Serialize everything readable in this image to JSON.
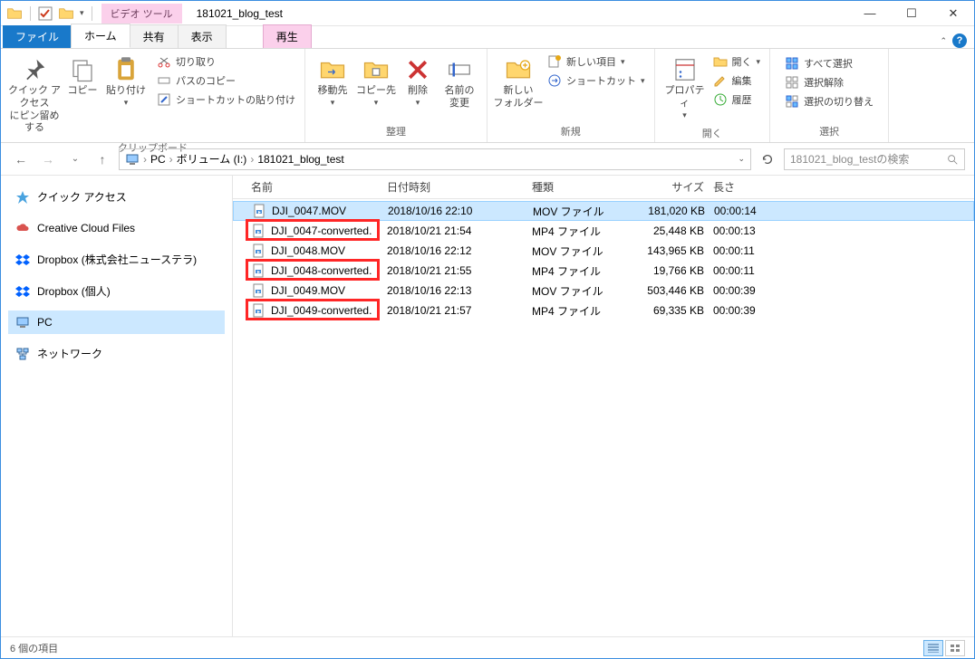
{
  "window": {
    "title": "181021_blog_test",
    "tool_context": "ビデオ ツール"
  },
  "tabs": {
    "file": "ファイル",
    "home": "ホーム",
    "share": "共有",
    "view": "表示",
    "play": "再生"
  },
  "ribbon": {
    "clipboard": {
      "pin": "クイック アクセス\nにピン留めする",
      "copy": "コピー",
      "paste": "貼り付け",
      "cut": "切り取り",
      "copy_path": "パスのコピー",
      "paste_shortcut": "ショートカットの貼り付け",
      "label": "クリップボード"
    },
    "organize": {
      "move_to": "移動先",
      "copy_to": "コピー先",
      "delete": "削除",
      "rename": "名前の\n変更",
      "label": "整理"
    },
    "new": {
      "new_folder": "新しい\nフォルダー",
      "new_item": "新しい項目",
      "shortcut": "ショートカット",
      "label": "新規"
    },
    "open": {
      "properties": "プロパティ",
      "open": "開く",
      "edit": "編集",
      "history": "履歴",
      "label": "開く"
    },
    "select": {
      "select_all": "すべて選択",
      "select_none": "選択解除",
      "invert": "選択の切り替え",
      "label": "選択"
    }
  },
  "breadcrumb": {
    "pc": "PC",
    "volume": "ボリューム (I:)",
    "folder": "181021_blog_test"
  },
  "search": {
    "placeholder": "181021_blog_testの検索"
  },
  "sidebar": {
    "quick_access": "クイック アクセス",
    "creative_cloud": "Creative Cloud Files",
    "dropbox_corp": "Dropbox (株式会社ニューステラ)",
    "dropbox_personal": "Dropbox (個人)",
    "pc": "PC",
    "network": "ネットワーク"
  },
  "columns": {
    "name": "名前",
    "date": "日付時刻",
    "type": "種類",
    "size": "サイズ",
    "length": "長さ"
  },
  "files": [
    {
      "name": "DJI_0047.MOV",
      "date": "2018/10/16 22:10",
      "type": "MOV ファイル",
      "size": "181,020 KB",
      "length": "00:00:14",
      "selected": true,
      "highlight": false
    },
    {
      "name": "DJI_0047-converted.",
      "date": "2018/10/21 21:54",
      "type": "MP4 ファイル",
      "size": "25,448 KB",
      "length": "00:00:13",
      "selected": false,
      "highlight": true
    },
    {
      "name": "DJI_0048.MOV",
      "date": "2018/10/16 22:12",
      "type": "MOV ファイル",
      "size": "143,965 KB",
      "length": "00:00:11",
      "selected": false,
      "highlight": false
    },
    {
      "name": "DJI_0048-converted.",
      "date": "2018/10/21 21:55",
      "type": "MP4 ファイル",
      "size": "19,766 KB",
      "length": "00:00:11",
      "selected": false,
      "highlight": true
    },
    {
      "name": "DJI_0049.MOV",
      "date": "2018/10/16 22:13",
      "type": "MOV ファイル",
      "size": "503,446 KB",
      "length": "00:00:39",
      "selected": false,
      "highlight": false
    },
    {
      "name": "DJI_0049-converted.",
      "date": "2018/10/21 21:57",
      "type": "MP4 ファイル",
      "size": "69,335 KB",
      "length": "00:00:39",
      "selected": false,
      "highlight": true
    }
  ],
  "status": {
    "items": "6 個の項目"
  }
}
